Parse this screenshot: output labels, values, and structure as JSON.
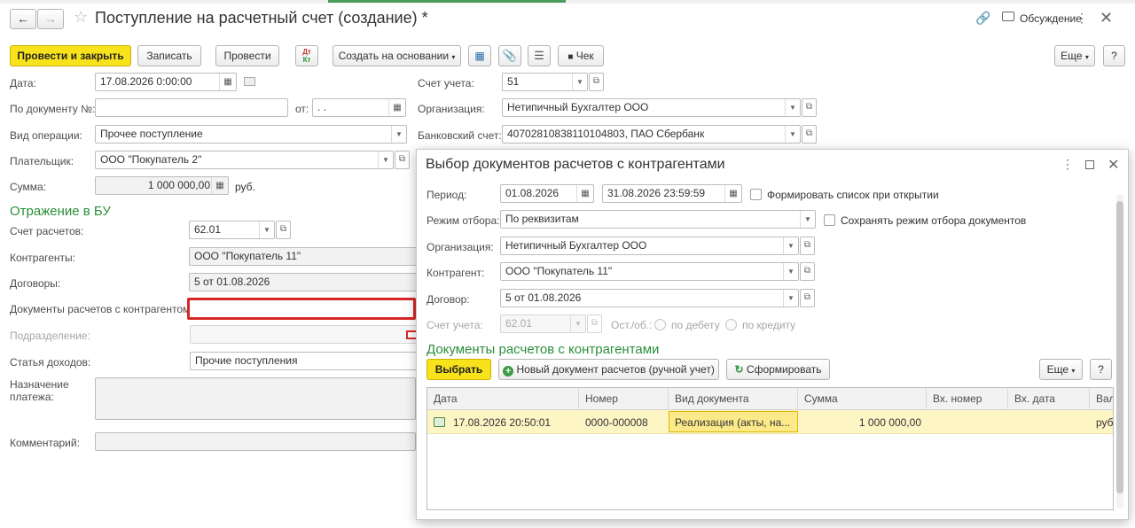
{
  "window": {
    "title": "Поступление на расчетный счет (создание) *",
    "discussion_label": "Обсуждение"
  },
  "toolbar": {
    "post_and_close": "Провести и закрыть",
    "save": "Записать",
    "post": "Провести",
    "dtkt": "Дт\nКт",
    "create_based_on": "Создать на основании",
    "check": "Чек",
    "more": "Еще",
    "help": "?"
  },
  "form": {
    "date_label": "Дата:",
    "date_value": "17.08.2026  0:00:00",
    "doc_no_label": "По документу №:",
    "doc_no_value": "",
    "from_label": "от:",
    "from_value": " .  .",
    "operation_label": "Вид операции:",
    "operation_value": "Прочее поступление",
    "payer_label": "Плательщик:",
    "payer_value": "ООО \"Покупатель 2\"",
    "sum_label": "Сумма:",
    "sum_value": "1 000 000,00",
    "sum_currency": "руб.",
    "account_label": "Счет учета:",
    "account_value": "51",
    "org_label": "Организация:",
    "org_value": "Нетипичный Бухгалтер ООО",
    "bank_label": "Банковский счет:",
    "bank_value": "40702810838110104803, ПАО Сбербанк",
    "bu_section": "Отражение в БУ",
    "settle_account_label": "Счет расчетов:",
    "settle_account_value": "62.01",
    "counterparties_label": "Контрагенты:",
    "counterparties_value": "ООО \"Покупатель 11\"",
    "contracts_label": "Договоры:",
    "contracts_value": "5 от 01.08.2026",
    "settle_docs_label": "Документы расчетов с контрагентом:",
    "settle_docs_value": "",
    "division_label": "Подразделение:",
    "division_value": "",
    "income_item_label": "Статья доходов:",
    "income_item_value": "Прочие поступления",
    "purpose_label": "Назначение платежа:",
    "purpose_value": "",
    "comment_label": "Комментарий:",
    "comment_value": ""
  },
  "dialog": {
    "title": "Выбор документов расчетов с контрагентами",
    "period_label": "Период:",
    "period_from": "01.08.2026",
    "period_to": "31.08.2026 23:59:59",
    "form_on_open_label": "Формировать список при открытии",
    "filter_mode_label": "Режим отбора:",
    "filter_mode_value": "По реквизитам",
    "save_filter_label": "Сохранять режим отбора документов",
    "org_label": "Организация:",
    "org_value": "Нетипичный Бухгалтер ООО",
    "counterparty_label": "Контрагент:",
    "counterparty_value": "ООО \"Покупатель 11\"",
    "contract_label": "Договор:",
    "contract_value": "5 от 01.08.2026",
    "account_label": "Счет учета:",
    "account_value": "62.01",
    "balance_label": "Ост./об.:",
    "debit_label": "по дебету",
    "credit_label": "по кредиту",
    "section_title": "Документы расчетов с контрагентами",
    "select_button": "Выбрать",
    "new_doc_button": "Новый документ расчетов (ручной учет)",
    "form_button": "Сформировать",
    "more_button": "Еще",
    "help_button": "?",
    "columns": [
      "Дата",
      "Номер",
      "Вид документа",
      "Сумма",
      "Вх. номер",
      "Вх. дата",
      "Вал"
    ],
    "rows": [
      {
        "date": "17.08.2026 20:50:01",
        "number": "0000-000008",
        "doc_type": "Реализация (акты, на...",
        "sum": "1 000 000,00",
        "in_number": "",
        "in_date": "",
        "currency": "руб"
      }
    ]
  },
  "colors": {
    "accent_yellow": "#f8e21b",
    "section_green": "#2b8f3a",
    "highlight_red": "#d62728",
    "selected_row": "#fdf5c4"
  }
}
